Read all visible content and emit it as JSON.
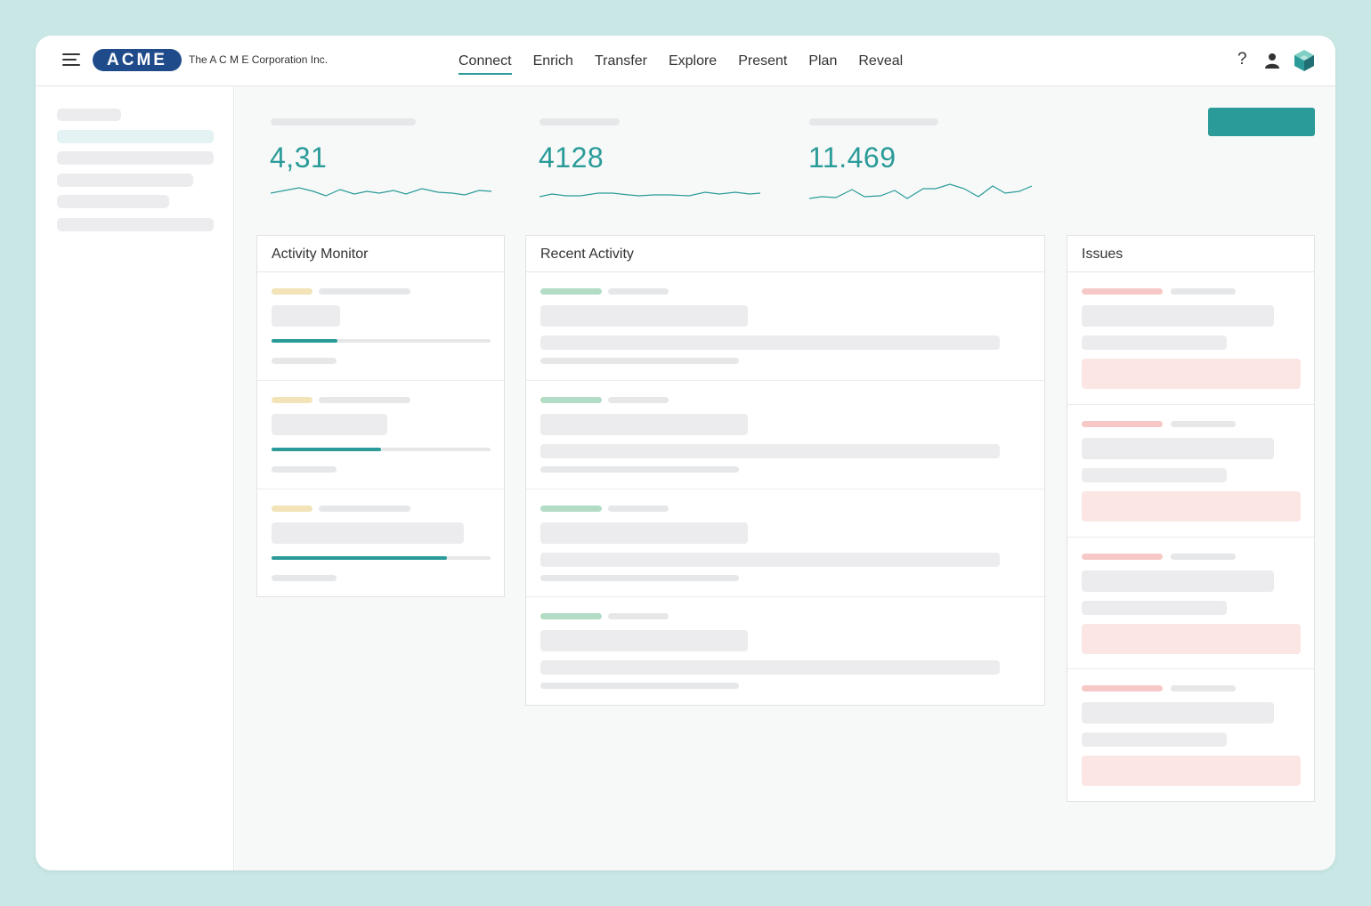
{
  "header": {
    "logo_text": "ACME",
    "company_name": "The A C M E Corporation Inc.",
    "nav": [
      {
        "label": "Connect",
        "active": true
      },
      {
        "label": "Enrich"
      },
      {
        "label": "Transfer"
      },
      {
        "label": "Explore"
      },
      {
        "label": "Present"
      },
      {
        "label": "Plan"
      },
      {
        "label": "Reveal"
      }
    ],
    "help_glyph": "?",
    "icons": [
      "menu-icon",
      "help-icon",
      "user-icon",
      "cube-logo-icon"
    ]
  },
  "stats": [
    {
      "value": "4,31"
    },
    {
      "value": "4128"
    },
    {
      "value": "11.469"
    }
  ],
  "panels": {
    "activity_monitor": {
      "title": "Activity Monitor",
      "progress": [
        0.3,
        0.5,
        0.8
      ]
    },
    "recent_activity": {
      "title": "Recent Activity"
    },
    "issues": {
      "title": "Issues"
    }
  },
  "colors": {
    "accent": "#2a9b98",
    "logo": "#1f4b8a",
    "background": "#c8e7e5",
    "warning_tag": "#f3e3b8",
    "success_tag": "#b2dcc5",
    "error_tag": "#f6c9c6",
    "error_block": "#fbe6e4"
  }
}
